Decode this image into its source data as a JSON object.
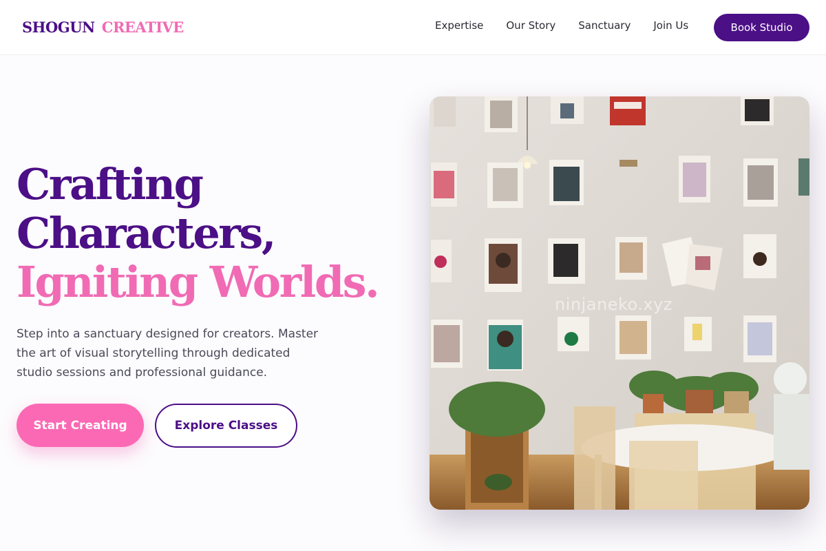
{
  "brand": {
    "part1": "SHOGUN",
    "part2": "CREATIVE"
  },
  "nav": {
    "items": [
      {
        "label": "Expertise"
      },
      {
        "label": "Our Story"
      },
      {
        "label": "Sanctuary"
      },
      {
        "label": "Join Us"
      }
    ],
    "cta_label": "Book Studio"
  },
  "hero": {
    "title_line1": "Crafting",
    "title_line2": "Characters,",
    "title_line3": "Igniting Worlds.",
    "description": "Step into a sanctuary designed for creators. Master the art of visual storytelling through dedicated studio sessions and professional guidance.",
    "primary_button": "Start Creating",
    "secondary_button": "Explore Classes",
    "image_watermark": "ninjaneko.xyz"
  },
  "colors": {
    "brand_purple": "#4b0f86",
    "brand_pink": "#f06bb4",
    "button_pink": "#fb69b4",
    "background": "#fcfbfd"
  }
}
